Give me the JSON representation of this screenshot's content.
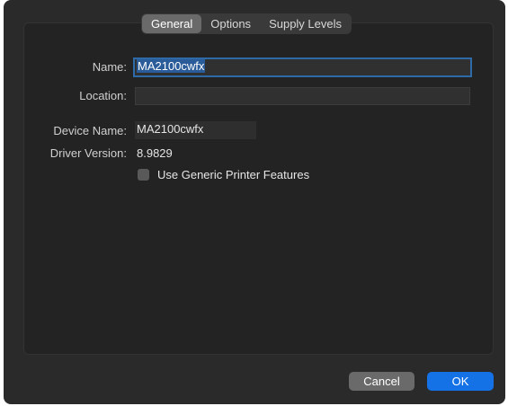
{
  "tabs": [
    {
      "label": "General",
      "active": true
    },
    {
      "label": "Options",
      "active": false
    },
    {
      "label": "Supply Levels",
      "active": false
    }
  ],
  "form": {
    "name_label": "Name:",
    "name_value": "MA2100cwfx",
    "location_label": "Location:",
    "location_value": "",
    "device_name_label": "Device Name:",
    "device_name_value": "MA2100cwfx",
    "driver_version_label": "Driver Version:",
    "driver_version_value": "8.9829",
    "generic_checkbox_label": "Use Generic Printer Features",
    "generic_checkbox_checked": false
  },
  "buttons": {
    "cancel_label": "Cancel",
    "ok_label": "OK"
  },
  "colors": {
    "window_bg": "#2a2a2a",
    "accent": "#1472e6",
    "selection": "#2b5c9a"
  }
}
